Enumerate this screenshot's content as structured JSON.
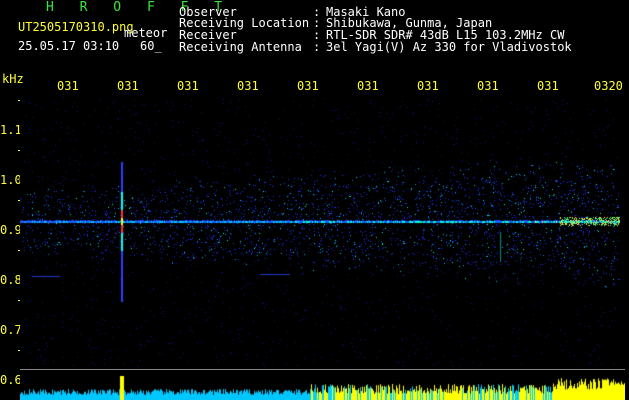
{
  "header": {
    "program": "H R O F F T",
    "filename": "UT2505170310.png",
    "type_label": "meteor",
    "datetime": "25.05.17 03:10",
    "duration": "60_"
  },
  "info": [
    {
      "label": "Observer",
      "value": "Masaki Kano"
    },
    {
      "label": "Receiving Location",
      "value": "Shibukawa, Gunma, Japan"
    },
    {
      "label": "Receiver",
      "value": "RTL-SDR SDR# 43dB L15 103.2MHz CW"
    },
    {
      "label": "Receiving Antenna",
      "value": "3el Yagi(V) Az 330 for Vladivostok"
    }
  ],
  "axis": {
    "y_unit": "kHz",
    "y_ticks": [
      "1.1",
      "1.0",
      "0.9",
      "0.8",
      "0.7",
      "0.6"
    ],
    "x_ticks": [
      "031",
      "031",
      "031",
      "031",
      "031",
      "031",
      "031",
      "031",
      "031",
      "0320"
    ]
  },
  "colors": {
    "text_white": "#ffffff",
    "text_yellow": "#ffff33",
    "text_green": "#39e639",
    "band_low": "#1a2fff",
    "band_high": "#00ffff",
    "amp_cyan": "#00ccff",
    "amp_yellow": "#ffff00"
  }
}
